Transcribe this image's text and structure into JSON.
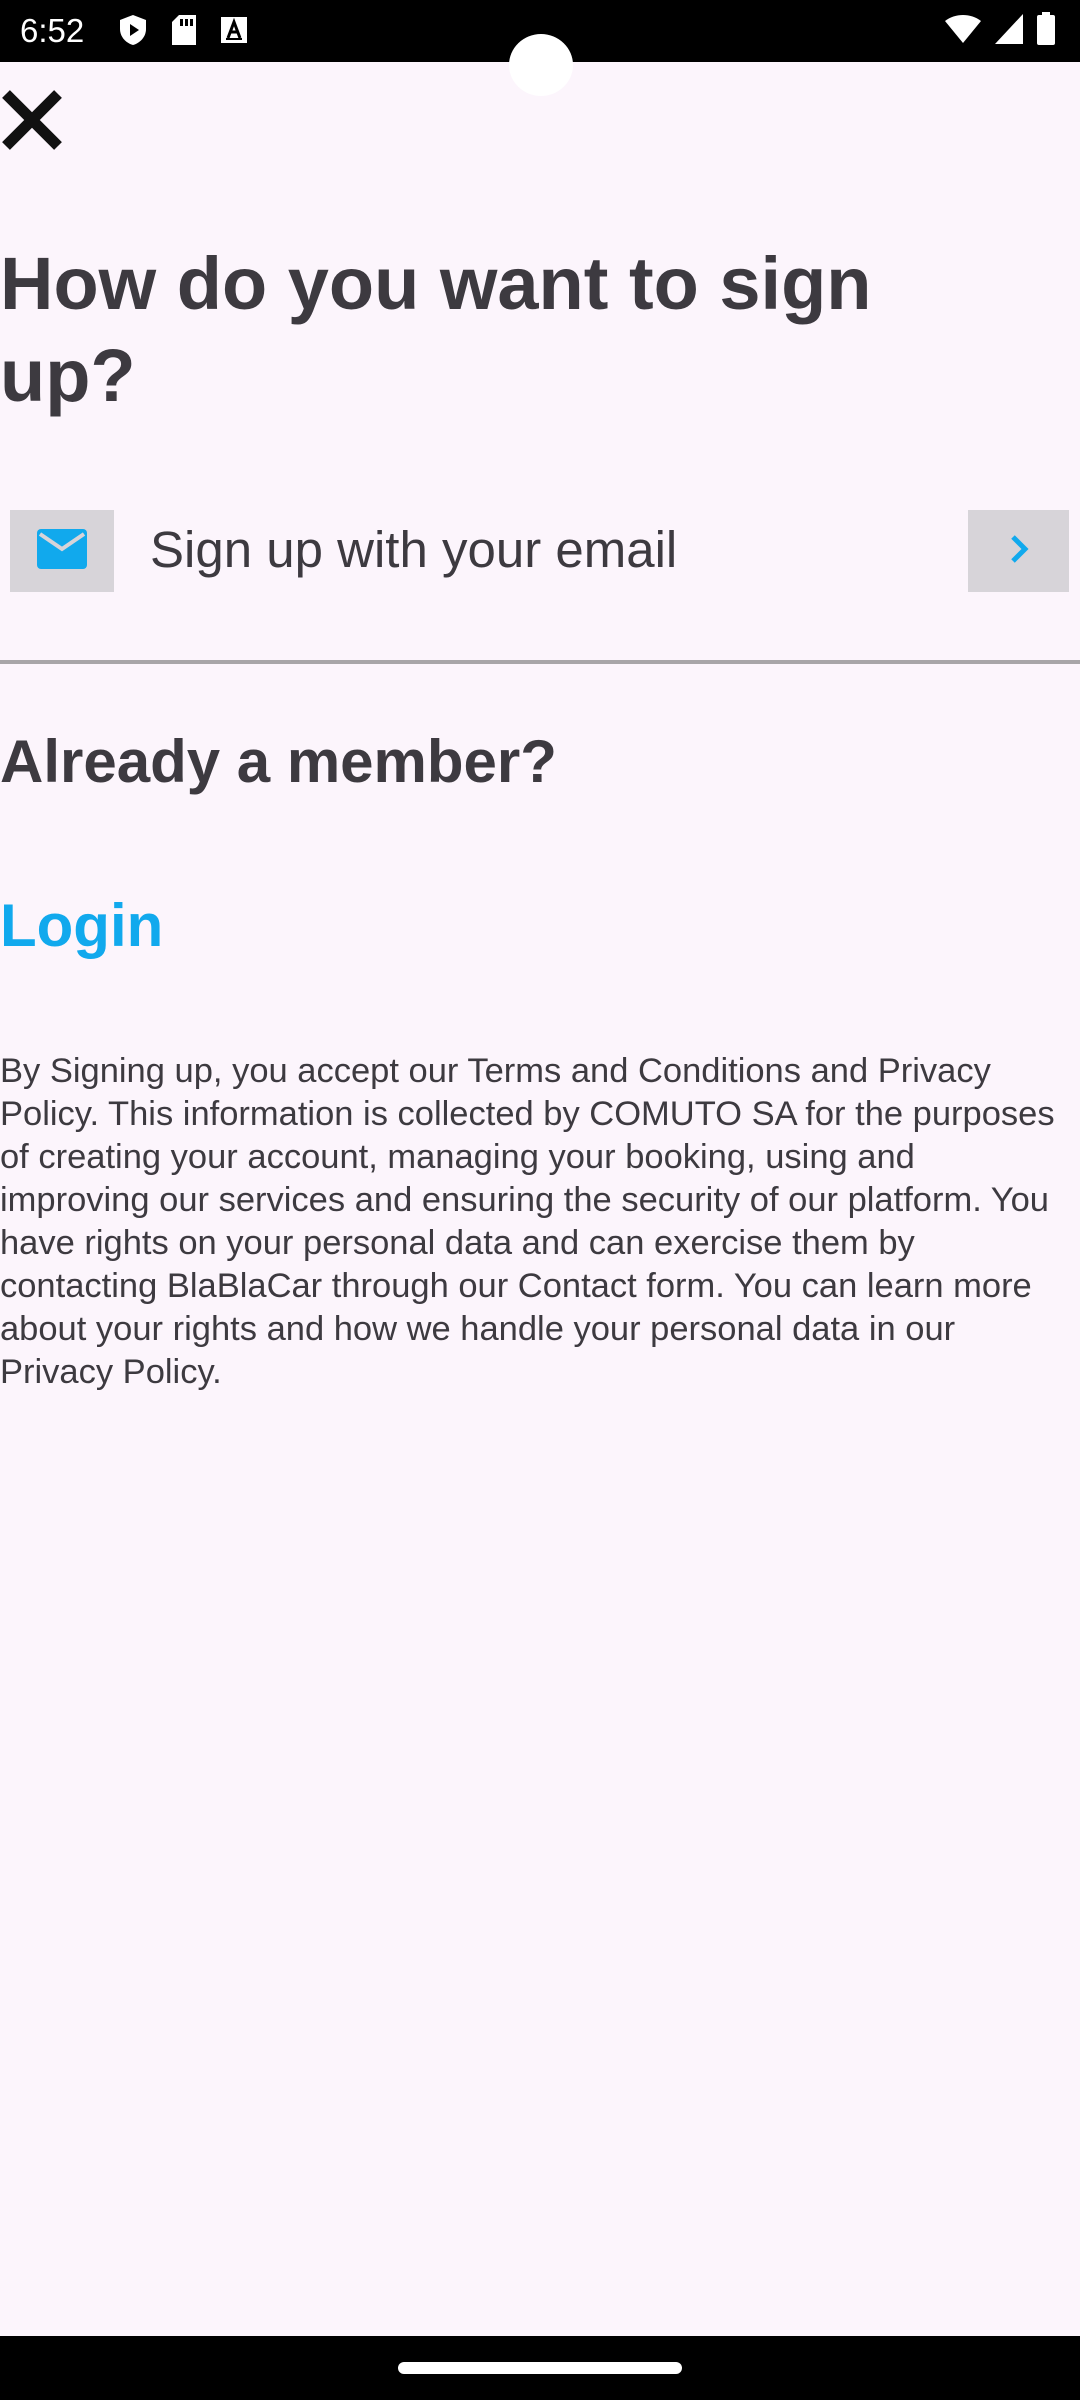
{
  "status_bar": {
    "time": "6:52",
    "left_icons": [
      "shield-play-icon",
      "sd-card-icon",
      "font-a-icon"
    ],
    "right_icons": [
      "wifi-icon",
      "signal-icon",
      "battery-icon"
    ]
  },
  "header": {
    "close_icon": "close-icon"
  },
  "main": {
    "title": "How do you want to sign up?",
    "email_option": {
      "label": "Sign up with your email",
      "icon": "email-icon",
      "chevron_icon": "chevron-right-icon"
    },
    "member_heading": "Already a member?",
    "login_label": "Login",
    "legal_text": "By Signing up, you accept our Terms and Conditions and Privacy Policy. This information is collected by COMUTO SA for the purposes of creating your account, managing your booking, using and improving our services and ensuring the security of our platform. You have rights on your personal data and can exercise them by contacting BlaBlaCar through our Contact form. You can learn more about your rights and how we handle your personal data in our Privacy Policy."
  },
  "colors": {
    "background": "#fcf5fc",
    "text": "#3d3a40",
    "accent": "#11a9ed",
    "button_bg": "#d7d4d9",
    "divider": "#a8a5a8"
  }
}
